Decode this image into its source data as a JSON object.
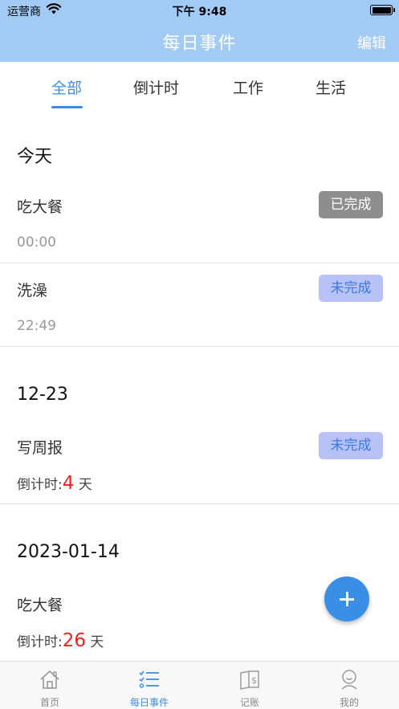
{
  "status_bar": {
    "carrier": "运营商",
    "time": "下午 9:48"
  },
  "nav": {
    "title": "每日事件",
    "edit_label": "编辑"
  },
  "tabs": [
    {
      "label": "全部",
      "active": true
    },
    {
      "label": "倒计时",
      "active": false
    },
    {
      "label": "工作",
      "active": false
    },
    {
      "label": "生活",
      "active": false
    }
  ],
  "groups": [
    {
      "date": "今天",
      "items": [
        {
          "title": "吃大餐",
          "time": "00:00",
          "status": "已完成"
        },
        {
          "title": "洗澡",
          "time": "22:49",
          "status": "未完成"
        }
      ]
    },
    {
      "date": "12-23",
      "items": [
        {
          "title": "写周报",
          "countdown_label": "倒计时:",
          "countdown_value": "4",
          "countdown_unit": "天",
          "status": "未完成"
        }
      ]
    },
    {
      "date": "2023-01-14",
      "items": [
        {
          "title": "吃大餐",
          "countdown_label": "倒计时:",
          "countdown_value": "26",
          "countdown_unit": "天"
        }
      ]
    }
  ],
  "tabbar": [
    {
      "label": "首页",
      "icon": "home-icon",
      "active": false
    },
    {
      "label": "每日事件",
      "icon": "checklist-icon",
      "active": true
    },
    {
      "label": "记账",
      "icon": "ledger-icon",
      "active": false
    },
    {
      "label": "我的",
      "icon": "profile-icon",
      "active": false
    }
  ],
  "colors": {
    "nav_bg": "#a1cbf5",
    "accent": "#3a8ee6",
    "countdown": "#f41e1e",
    "done_badge": "#8e8e8e",
    "todo_badge": "#b9c2f7"
  }
}
